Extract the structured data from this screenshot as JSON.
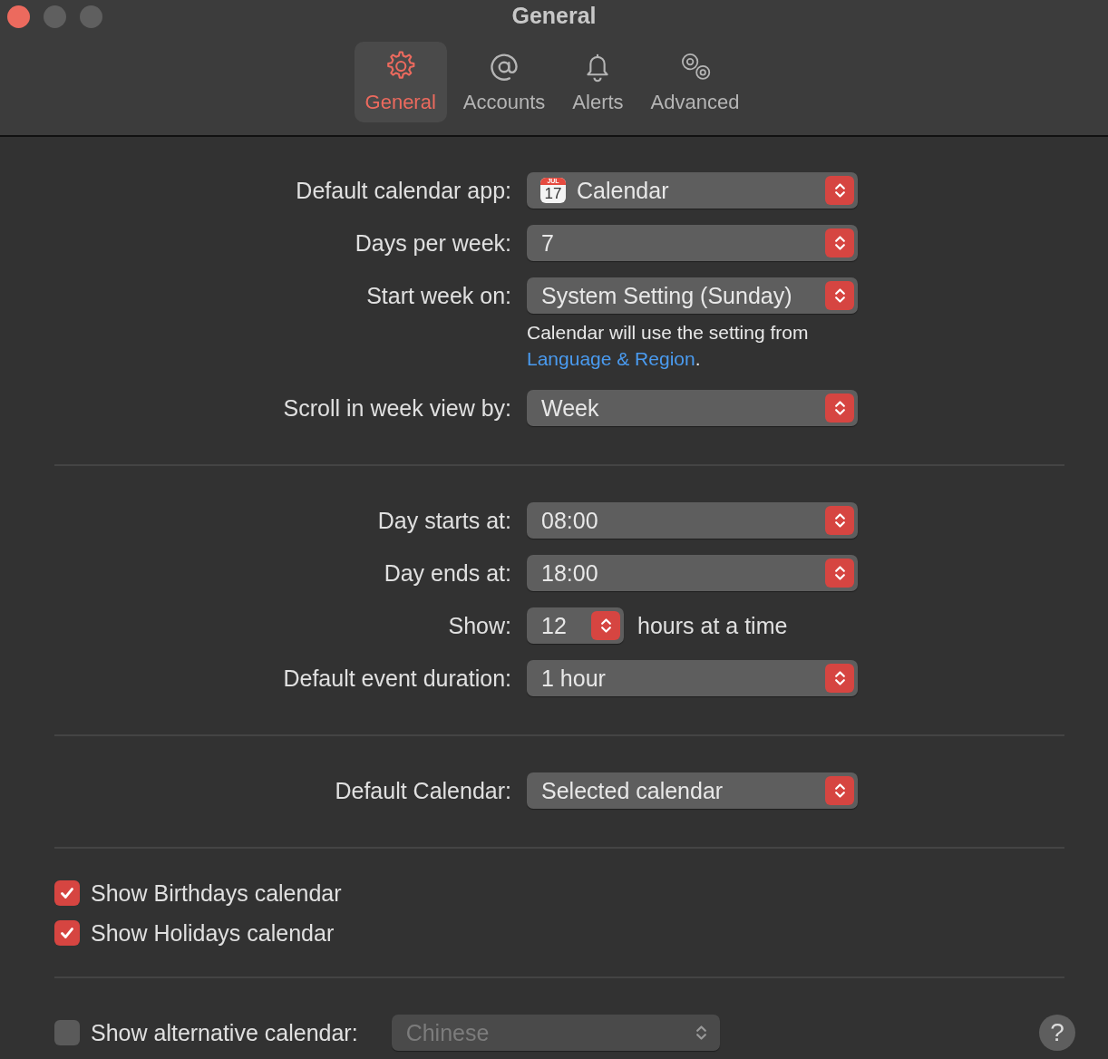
{
  "window": {
    "title": "General"
  },
  "tabs": [
    {
      "label": "General",
      "selected": true
    },
    {
      "label": "Accounts",
      "selected": false
    },
    {
      "label": "Alerts",
      "selected": false
    },
    {
      "label": "Advanced",
      "selected": false
    }
  ],
  "sections": [
    {
      "rows": [
        {
          "kind": "popup",
          "label": "Default calendar app:",
          "value": "Calendar",
          "app_icon": {
            "month": "JUL",
            "day": "17"
          }
        },
        {
          "kind": "popup",
          "label": "Days per week:",
          "value": "7"
        },
        {
          "kind": "popup",
          "label": "Start week on:",
          "value": "System Setting (Sunday)",
          "note": {
            "before": "Calendar will use the setting from ",
            "link": "Language & Region",
            "after": "."
          }
        },
        {
          "kind": "popup",
          "label": "Scroll in week view by:",
          "value": "Week"
        }
      ]
    },
    {
      "rows": [
        {
          "kind": "popup",
          "label": "Day starts at:",
          "value": "08:00"
        },
        {
          "kind": "popup",
          "label": "Day ends at:",
          "value": "18:00"
        },
        {
          "kind": "short_popup",
          "label": "Show:",
          "value": "12",
          "suffix": "hours at a time"
        },
        {
          "kind": "popup",
          "label": "Default event duration:",
          "value": "1 hour"
        }
      ]
    },
    {
      "rows": [
        {
          "kind": "popup",
          "label": "Default Calendar:",
          "value": "Selected calendar"
        }
      ]
    }
  ],
  "checkboxes": [
    {
      "label": "Show Birthdays calendar",
      "checked": true
    },
    {
      "label": "Show Holidays calendar",
      "checked": true
    }
  ],
  "alternative": {
    "label": "Show alternative calendar:",
    "checked": false,
    "value": "Chinese",
    "disabled": true
  },
  "help_button": "?"
}
